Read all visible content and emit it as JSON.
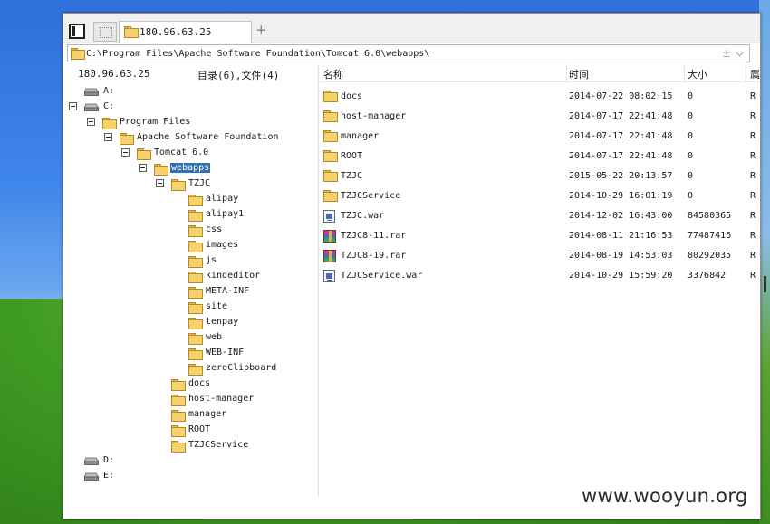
{
  "colors": {
    "selection": "#2f6fb6",
    "folder": "#f6d26c",
    "window_bg": "#ffffff"
  },
  "tab": {
    "title": "180.96.63.25",
    "add": "+"
  },
  "address": {
    "path": "C:\\Program Files\\Apache Software Foundation\\Tomcat 6.0\\webapps\\",
    "plus": "±",
    "dropdown": "⌵"
  },
  "left_header": {
    "host": "180.96.63.25",
    "count": "目录(6),文件(4)"
  },
  "tree": [
    {
      "label": "A:",
      "kind": "drive"
    },
    {
      "label": "C:",
      "kind": "drive",
      "expanded": true
    },
    {
      "label": "Program Files",
      "kind": "folder",
      "expanded": true
    },
    {
      "label": "Apache Software Foundation",
      "kind": "folder",
      "expanded": true
    },
    {
      "label": "Tomcat 6.0",
      "kind": "folder",
      "expanded": true
    },
    {
      "label": "webapps",
      "kind": "folder",
      "expanded": true,
      "selected": true
    },
    {
      "label": "TZJC",
      "kind": "folder",
      "expanded": true
    },
    {
      "label": "alipay",
      "kind": "folder"
    },
    {
      "label": "alipay1",
      "kind": "folder"
    },
    {
      "label": "css",
      "kind": "folder"
    },
    {
      "label": "images",
      "kind": "folder"
    },
    {
      "label": "js",
      "kind": "folder"
    },
    {
      "label": "kindeditor",
      "kind": "folder"
    },
    {
      "label": "META-INF",
      "kind": "folder"
    },
    {
      "label": "site",
      "kind": "folder"
    },
    {
      "label": "tenpay",
      "kind": "folder"
    },
    {
      "label": "web",
      "kind": "folder"
    },
    {
      "label": "WEB-INF",
      "kind": "folder"
    },
    {
      "label": "zeroClipboard",
      "kind": "folder"
    },
    {
      "label": "docs",
      "kind": "folder"
    },
    {
      "label": "host-manager",
      "kind": "folder"
    },
    {
      "label": "manager",
      "kind": "folder"
    },
    {
      "label": "ROOT",
      "kind": "folder"
    },
    {
      "label": "TZJCService",
      "kind": "folder"
    },
    {
      "label": "D:",
      "kind": "drive"
    },
    {
      "label": "E:",
      "kind": "drive"
    }
  ],
  "columns": {
    "name": "名称",
    "time": "时间",
    "size": "大小",
    "attr": "属"
  },
  "files": [
    {
      "name": "docs",
      "time": "2014-07-22 08:02:15",
      "size": "0",
      "attr": "R",
      "icon": "folder"
    },
    {
      "name": "host-manager",
      "time": "2014-07-17 22:41:48",
      "size": "0",
      "attr": "R",
      "icon": "folder"
    },
    {
      "name": "manager",
      "time": "2014-07-17 22:41:48",
      "size": "0",
      "attr": "R",
      "icon": "folder"
    },
    {
      "name": "ROOT",
      "time": "2014-07-17 22:41:48",
      "size": "0",
      "attr": "R",
      "icon": "folder"
    },
    {
      "name": "TZJC",
      "time": "2015-05-22 20:13:57",
      "size": "0",
      "attr": "R",
      "icon": "folder"
    },
    {
      "name": "TZJCService",
      "time": "2014-10-29 16:01:19",
      "size": "0",
      "attr": "R",
      "icon": "folder"
    },
    {
      "name": "TZJC.war",
      "time": "2014-12-02 16:43:00",
      "size": "84580365",
      "attr": "R",
      "icon": "war"
    },
    {
      "name": "TZJC8-11.rar",
      "time": "2014-08-11 21:16:53",
      "size": "77487416",
      "attr": "R",
      "icon": "rar"
    },
    {
      "name": "TZJC8-19.rar",
      "time": "2014-08-19 14:53:03",
      "size": "80292035",
      "attr": "R",
      "icon": "rar"
    },
    {
      "name": "TZJCService.war",
      "time": "2014-10-29 15:59:20",
      "size": "3376842",
      "attr": "R",
      "icon": "war"
    }
  ],
  "watermark": "www.wooyun.org"
}
